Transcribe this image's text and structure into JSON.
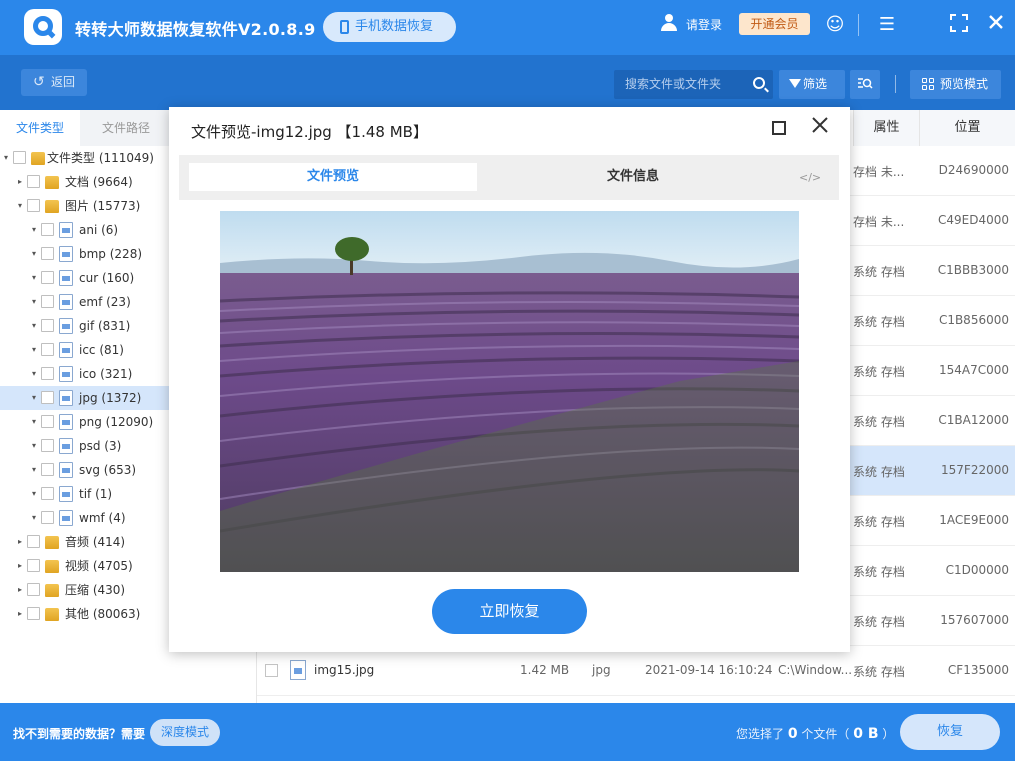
{
  "app": {
    "title": "转转大师数据恢复软件V2.0.8.9",
    "mobile_btn": "手机数据恢复",
    "login": "请登录",
    "vip": "开通会员"
  },
  "toolbar": {
    "back": "返回",
    "search_placeholder": "搜索文件或文件夹",
    "filter": "筛选",
    "preview_mode": "预览模式"
  },
  "left_tabs": {
    "type": "文件类型",
    "path": "文件路径"
  },
  "tree": [
    {
      "label": "文件类型 (111049)",
      "level": 0,
      "toggle": "▾",
      "icon": "folder"
    },
    {
      "label": "文档 (9664)",
      "level": 1,
      "toggle": "▸",
      "icon": "folder"
    },
    {
      "label": "图片 (15773)",
      "level": 1,
      "toggle": "▾",
      "icon": "folder"
    },
    {
      "label": "ani (6)",
      "level": 2,
      "toggle": "▾",
      "icon": "file"
    },
    {
      "label": "bmp (228)",
      "level": 2,
      "toggle": "▾",
      "icon": "file"
    },
    {
      "label": "cur (160)",
      "level": 2,
      "toggle": "▾",
      "icon": "file"
    },
    {
      "label": "emf (23)",
      "level": 2,
      "toggle": "▾",
      "icon": "file"
    },
    {
      "label": "gif (831)",
      "level": 2,
      "toggle": "▾",
      "icon": "file"
    },
    {
      "label": "icc (81)",
      "level": 2,
      "toggle": "▾",
      "icon": "file"
    },
    {
      "label": "ico (321)",
      "level": 2,
      "toggle": "▾",
      "icon": "file"
    },
    {
      "label": "jpg (1372)",
      "level": 2,
      "toggle": "▾",
      "icon": "file",
      "selected": true
    },
    {
      "label": "png (12090)",
      "level": 2,
      "toggle": "▾",
      "icon": "file"
    },
    {
      "label": "psd (3)",
      "level": 2,
      "toggle": "▾",
      "icon": "file"
    },
    {
      "label": "svg (653)",
      "level": 2,
      "toggle": "▾",
      "icon": "file"
    },
    {
      "label": "tif (1)",
      "level": 2,
      "toggle": "▾",
      "icon": "file"
    },
    {
      "label": "wmf (4)",
      "level": 2,
      "toggle": "▾",
      "icon": "file"
    },
    {
      "label": "音频 (414)",
      "level": 1,
      "toggle": "▸",
      "icon": "folder"
    },
    {
      "label": "视频 (4705)",
      "level": 1,
      "toggle": "▸",
      "icon": "folder"
    },
    {
      "label": "压缩 (430)",
      "level": 1,
      "toggle": "▸",
      "icon": "folder"
    },
    {
      "label": "其他 (80063)",
      "level": 1,
      "toggle": "▸",
      "icon": "folder"
    }
  ],
  "columns": {
    "attr": "属性",
    "loc": "位置"
  },
  "rows": [
    {
      "attr": "存档 未...",
      "loc": "D24690000"
    },
    {
      "attr": "存档 未...",
      "loc": "C49ED4000"
    },
    {
      "attr": "系统 存档",
      "loc": "C1BBB3000"
    },
    {
      "attr": "系统 存档",
      "loc": "C1B856000"
    },
    {
      "attr": "系统 存档",
      "loc": "154A7C000"
    },
    {
      "attr": "系统 存档",
      "loc": "C1BA12000"
    },
    {
      "attr": "系统 存档",
      "loc": "157F22000",
      "selected": true
    },
    {
      "attr": "系统 存档",
      "loc": "1ACE9E000"
    },
    {
      "attr": "系统 存档",
      "loc": "C1D00000"
    },
    {
      "attr": "系统 存档",
      "loc": "157607000"
    }
  ],
  "last_row": {
    "name": "img15.jpg",
    "size": "1.42 MB",
    "type": "jpg",
    "date": "2021-09-14 16:10:24",
    "path": "C:\\Window...",
    "attr": "系统 存档",
    "loc": "CF135000"
  },
  "bottom": {
    "hint": "找不到需要的数据？需要",
    "deep_mode": "深度模式",
    "sel_prefix": "您选择了",
    "sel_count": "0",
    "sel_mid": "个文件（",
    "sel_size": "0 B",
    "sel_suffix": "）",
    "recover": "恢复"
  },
  "modal": {
    "title": "文件预览-img12.jpg 【1.48 MB】",
    "tab_preview": "文件预览",
    "tab_info": "文件信息",
    "tab_code": "</>",
    "recover": "立即恢复"
  },
  "colors": {
    "primary": "#2b87ea",
    "toolbar": "#2273cf",
    "selection": "#d5e6fb"
  }
}
